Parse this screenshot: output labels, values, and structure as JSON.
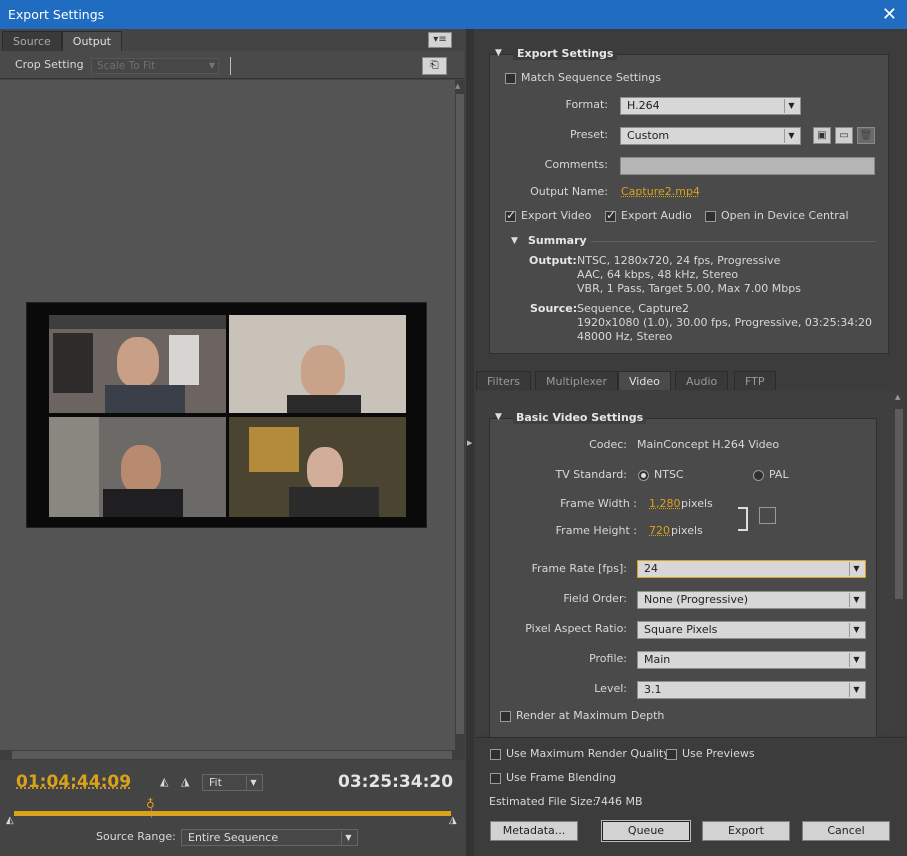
{
  "window": {
    "title": "Export Settings",
    "close": "✕"
  },
  "left": {
    "tabs": [
      "Source",
      "Output"
    ],
    "crop_label": "Crop Setting",
    "crop_value": "Scale To Fit",
    "timecode_current": "01:04:44:09",
    "timecode_duration": "03:25:34:20",
    "zoom_value": "Fit",
    "source_range_label": "Source Range:",
    "source_range_value": "Entire Sequence"
  },
  "export_settings": {
    "header": "Export Settings",
    "match_sequence": "Match Sequence Settings",
    "format_label": "Format:",
    "format_value": "H.264",
    "preset_label": "Preset:",
    "preset_value": "Custom",
    "comments_label": "Comments:",
    "output_name_label": "Output Name:",
    "output_name_value": "Capture2.mp4",
    "export_video": "Export Video",
    "export_audio": "Export Audio",
    "open_device_central": "Open in Device Central",
    "summary_header": "Summary",
    "output_label": "Output:",
    "output_lines": [
      "NTSC, 1280x720, 24 fps, Progressive",
      "AAC, 64 kbps, 48 kHz, Stereo",
      "VBR, 1 Pass, Target 5.00, Max 7.00 Mbps"
    ],
    "source_label": "Source:",
    "source_lines": [
      "Sequence, Capture2",
      "1920x1080 (1.0), 30.00 fps, Progressive, 03:25:34:20",
      "48000 Hz, Stereo"
    ]
  },
  "settings_tabs": [
    "Filters",
    "Multiplexer",
    "Video",
    "Audio",
    "FTP"
  ],
  "video": {
    "header": "Basic Video Settings",
    "codec_label": "Codec:",
    "codec_value": "MainConcept H.264 Video",
    "tv_standard_label": "TV Standard:",
    "ntsc": "NTSC",
    "pal": "PAL",
    "frame_width_label": "Frame Width :",
    "frame_width_value": "1,280",
    "frame_height_label": "Frame Height :",
    "frame_height_value": "720",
    "pixels": "pixels",
    "frame_rate_label": "Frame Rate [fps]:",
    "frame_rate_value": "24",
    "field_order_label": "Field Order:",
    "field_order_value": "None (Progressive)",
    "par_label": "Pixel Aspect Ratio:",
    "par_value": "Square Pixels",
    "profile_label": "Profile:",
    "profile_value": "Main",
    "level_label": "Level:",
    "level_value": "3.1",
    "render_max_depth": "Render at Maximum Depth"
  },
  "footer": {
    "max_render_quality": "Use Maximum Render Quality",
    "use_previews": "Use Previews",
    "frame_blending": "Use Frame Blending",
    "file_size_label": "Estimated File Size:",
    "file_size_value": "7446 MB",
    "metadata": "Metadata...",
    "queue": "Queue",
    "export": "Export",
    "cancel": "Cancel"
  },
  "colors": {
    "accent": "#d9a21b",
    "titlebar": "#1f6cc0"
  }
}
